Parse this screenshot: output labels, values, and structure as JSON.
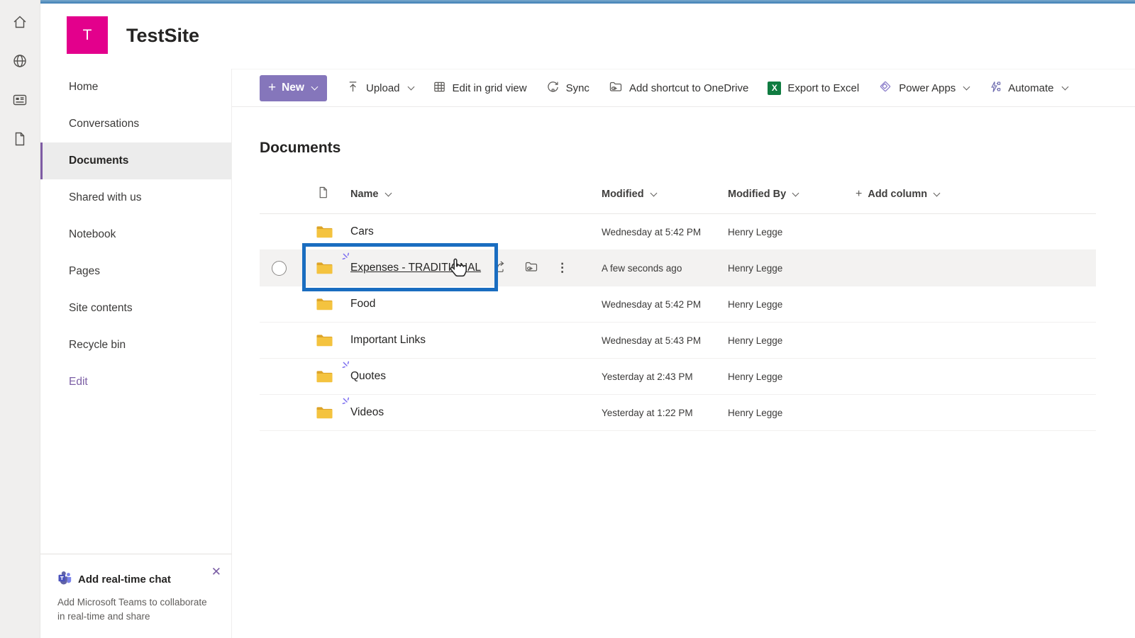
{
  "colors": {
    "top_bar_blue": "#3d7eb5",
    "brand_purple": "#8576bb",
    "logo_pink": "#e3008c",
    "selection_blue": "#1a6dc0",
    "excel_green": "#107c41",
    "folder_yellow": "#f2c140",
    "nav_selected_border": "#7e5ba4"
  },
  "glyphs": {
    "plus": "+",
    "ellipsis": "⋮",
    "close": "✕",
    "excel_x": "X"
  },
  "header": {
    "site_initial": "T",
    "site_title": "TestSite"
  },
  "sidebar": {
    "items": [
      {
        "label": "Home"
      },
      {
        "label": "Conversations"
      },
      {
        "label": "Documents",
        "selected": true
      },
      {
        "label": "Shared with us"
      },
      {
        "label": "Notebook"
      },
      {
        "label": "Pages"
      },
      {
        "label": "Site contents"
      },
      {
        "label": "Recycle bin"
      },
      {
        "label": "Edit",
        "link": true
      }
    ]
  },
  "toolbar": {
    "new_label": "New",
    "upload_label": "Upload",
    "grid_label": "Edit in grid view",
    "sync_label": "Sync",
    "shortcut_label": "Add shortcut to OneDrive",
    "excel_label": "Export to Excel",
    "powerapps_label": "Power Apps",
    "automate_label": "Automate"
  },
  "main": {
    "title": "Documents",
    "columns": {
      "name": "Name",
      "modified": "Modified",
      "modified_by": "Modified By",
      "add_column": "Add column"
    },
    "rows": [
      {
        "name": "Cars",
        "modified": "Wednesday at 5:42 PM",
        "modified_by": "Henry Legge",
        "is_new": false
      },
      {
        "name": "Expenses - TRADITIONAL",
        "modified": "A few seconds ago",
        "modified_by": "Henry Legge",
        "is_new": true,
        "highlighted": true
      },
      {
        "name": "Food",
        "modified": "Wednesday at 5:42 PM",
        "modified_by": "Henry Legge",
        "is_new": false
      },
      {
        "name": "Important Links",
        "modified": "Wednesday at 5:43 PM",
        "modified_by": "Henry Legge",
        "is_new": false
      },
      {
        "name": "Quotes",
        "modified": "Yesterday at 2:43 PM",
        "modified_by": "Henry Legge",
        "is_new": true
      },
      {
        "name": "Videos",
        "modified": "Yesterday at 1:22 PM",
        "modified_by": "Henry Legge",
        "is_new": true
      }
    ]
  },
  "promo": {
    "title": "Add real-time chat",
    "body": "Add Microsoft Teams to collaborate in real-time and share"
  }
}
